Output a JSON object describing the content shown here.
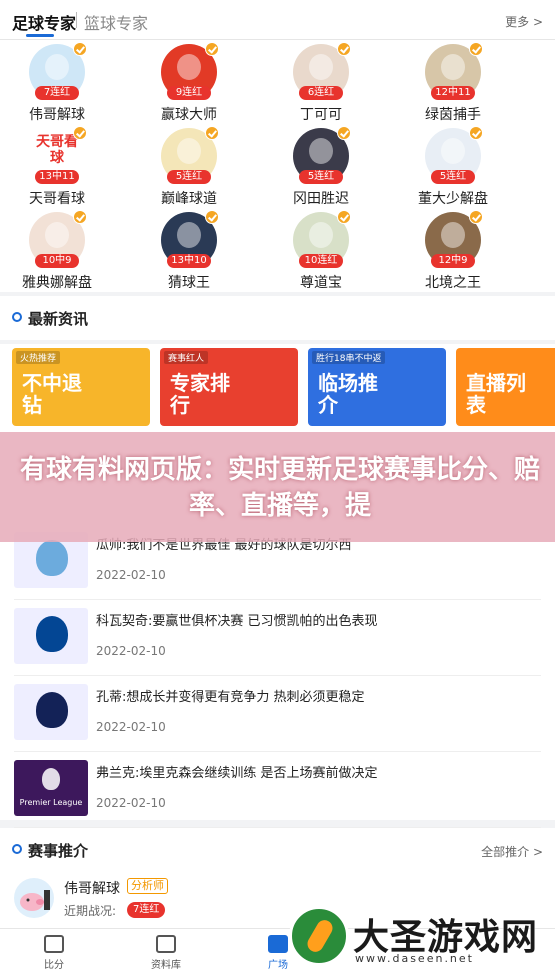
{
  "tabs": {
    "football": "足球专家",
    "basketball": "篮球专家",
    "more": "更多 >"
  },
  "experts": [
    {
      "name": "伟哥解球",
      "streak": "7连红",
      "avatar": "pig-cartoon-avatar"
    },
    {
      "name": "赢球大师",
      "streak": "9连红",
      "avatar": "win-character-avatar"
    },
    {
      "name": "丁可可",
      "streak": "6连红",
      "avatar": "woman-portrait-avatar"
    },
    {
      "name": "绿茵捕手",
      "streak": "12中11",
      "avatar": "dogs-avatar"
    },
    {
      "name": "天哥看球",
      "streak": "13中11",
      "avatar": "text-avatar",
      "avatar_text": "天哥看球"
    },
    {
      "name": "巅峰球道",
      "streak": "5连红",
      "avatar": "monk-cartoon-avatar"
    },
    {
      "name": "冈田胜迟",
      "streak": "5连红",
      "avatar": "player-avatar"
    },
    {
      "name": "董大少解盘",
      "streak": "5连红",
      "avatar": "balls-avatar"
    },
    {
      "name": "雅典娜解盘",
      "streak": "10中9",
      "avatar": "glasses-woman-avatar"
    },
    {
      "name": "猜球王",
      "streak": "13中10",
      "avatar": "robot-avatar"
    },
    {
      "name": "尊道宝",
      "streak": "10连红",
      "avatar": "anime-avatar"
    },
    {
      "name": "北境之王",
      "streak": "12中9",
      "avatar": "girl-portrait-avatar"
    }
  ],
  "news_section": {
    "title": "最新资讯"
  },
  "banners": [
    {
      "tag": "火热推荐",
      "text": "不中退钻",
      "color": "#f7b52a"
    },
    {
      "tag": "赛事红人",
      "text": "专家排行",
      "color": "#e8402f"
    },
    {
      "tag": "胜行18串不中返",
      "text": "临场推介",
      "color": "#2f6fe0"
    },
    {
      "tag": "",
      "text": "直播列表",
      "color": "#ff8c1a"
    }
  ],
  "overlay_text": "有球有料网页版：实时更新足球赛事比分、赔率、直播等，提",
  "news": [
    {
      "title": "瓜帅:我们不是世界最佳 最好的球队是切尔西",
      "date": "2022-02-10",
      "thumb": "man-city-badge",
      "thumb_color": "#6cabdd"
    },
    {
      "title": "科瓦契奇:要赢世俱杯决赛 已习惯凯帕的出色表现",
      "date": "2022-02-10",
      "thumb": "chelsea-badge",
      "thumb_color": "#034694"
    },
    {
      "title": "孔蒂:想成长并变得更有竞争力 热刺必须更稳定",
      "date": "2022-02-10",
      "thumb": "tottenham-badge",
      "thumb_color": "#132257"
    },
    {
      "title": "弗兰克:埃里克森会继续训练 是否上场赛前做决定",
      "date": "2022-02-10",
      "thumb": "premier-league-badge",
      "thumb_color": "#3d185c",
      "thumb_text": "Premier League"
    }
  ],
  "recommend": {
    "title": "赛事推介",
    "more": "全部推介 >",
    "expert_name": "伟哥解球",
    "expert_tag": "分析师",
    "recent_label": "近期战况:",
    "recent_streak": "7连红"
  },
  "nav": [
    {
      "label": "比分",
      "icon": "scoreboard-icon",
      "active": false
    },
    {
      "label": "资料库",
      "icon": "database-icon",
      "active": false
    },
    {
      "label": "广场",
      "icon": "plaza-icon",
      "active": true
    }
  ],
  "watermark": {
    "text": "大圣游戏网",
    "url": "www.daseen.net"
  },
  "colors": {
    "accent": "#1a6ad6",
    "streak_red": "#e8332d",
    "tag_orange": "#f39800"
  }
}
